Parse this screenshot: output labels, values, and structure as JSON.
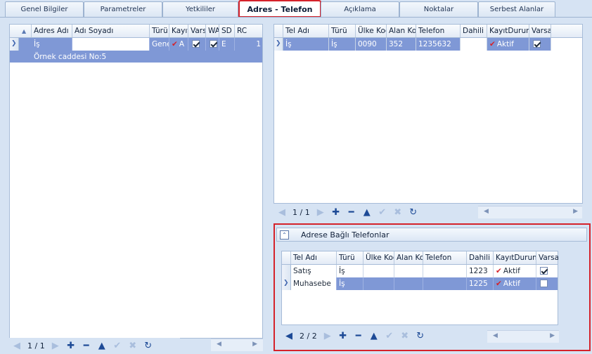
{
  "tabs": [
    {
      "label": "Genel Bilgiler"
    },
    {
      "label": "Parametreler"
    },
    {
      "label": "Yetkililer"
    },
    {
      "label": "Adres - Telefon"
    },
    {
      "label": "Açıklama"
    },
    {
      "label": "Noktalar"
    },
    {
      "label": "Serbest Alanlar"
    }
  ],
  "address_grid": {
    "headers": [
      "Adres Adı",
      "Adı Soyadı",
      "Türü",
      "Kayıt",
      "Vars",
      "WA",
      "SD",
      "RC"
    ],
    "row": {
      "adres_adi": "İş",
      "adi_soyadi": "",
      "turu": "Genel",
      "kayit": "A",
      "sd": "E",
      "rc": "1",
      "vars": true,
      "wa": true
    },
    "detail": "Örnek caddesi No:5",
    "pager": "1 / 1"
  },
  "phone_grid": {
    "headers": [
      "Tel Adı",
      "Türü",
      "Ülke Kod",
      "Alan Ko",
      "Telefon",
      "Dahili",
      "KayıtDurumu",
      "Varsa"
    ],
    "rows": [
      {
        "tel_adi": "İş",
        "turu": "İş",
        "ulke": "0090",
        "alan": "352",
        "telefon": "1235632",
        "dahili": "",
        "durum": "Aktif",
        "varsa": true
      }
    ],
    "pager": "1 / 1"
  },
  "linked_phones": {
    "title": "Adrese Bağlı Telefonlar",
    "headers": [
      "Tel Adı",
      "Türü",
      "Ülke Koc",
      "Alan Ko",
      "Telefon",
      "Dahili",
      "KayıtDurumu",
      "Varsa"
    ],
    "rows": [
      {
        "tel_adi": "Satış",
        "turu": "İş",
        "ulke": "",
        "alan": "",
        "telefon": "",
        "dahili": "1223",
        "durum": "Aktif",
        "varsa": true
      },
      {
        "tel_adi": "Muhasebe",
        "turu": "İş",
        "ulke": "",
        "alan": "",
        "telefon": "",
        "dahili": "1225",
        "durum": "Aktif",
        "varsa": false
      }
    ],
    "pager": "2 / 2"
  },
  "icons": {
    "first": "◀",
    "next": "▶",
    "add": "✚",
    "remove": "━",
    "up": "▲",
    "confirm": "✔",
    "cancel": "✖",
    "refresh": "↻",
    "scroll_left": "◀",
    "scroll_right": "▶",
    "row_indicator": "❯",
    "sort": "▲",
    "collapse": "⌃"
  },
  "colors": {
    "selected_row": "#7f98d6",
    "highlight_border": "#d5222a",
    "background": "#d6e3f3"
  }
}
